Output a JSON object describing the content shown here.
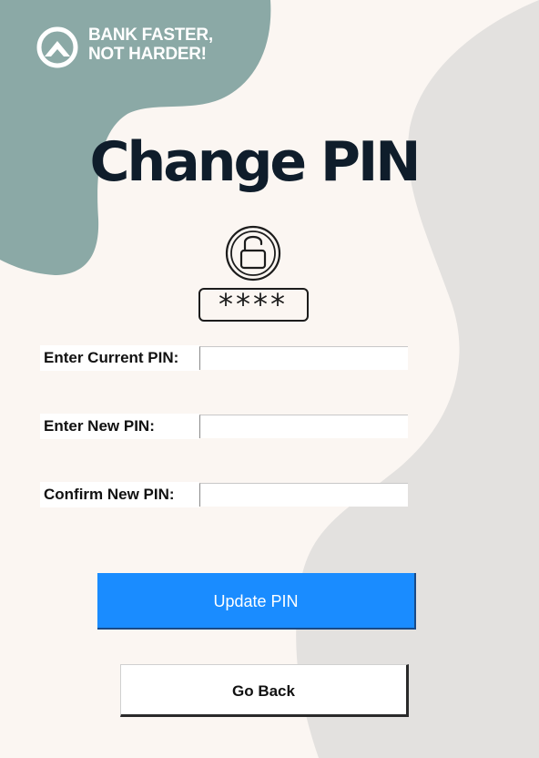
{
  "brand": {
    "line1": "BANK FASTER,",
    "line2": "NOT HARDER!",
    "logo_icon": "mountain-logo-icon"
  },
  "page": {
    "title": "Change PIN"
  },
  "illustration": {
    "lock_icon": "unlocked-padlock-icon",
    "masked_pin": "****"
  },
  "form": {
    "current_pin": {
      "label": "Enter Current PIN:",
      "value": ""
    },
    "new_pin": {
      "label": "Enter New PIN:",
      "value": ""
    },
    "confirm_pin": {
      "label": "Confirm New PIN:",
      "value": ""
    }
  },
  "buttons": {
    "update_label": "Update PIN",
    "back_label": "Go Back"
  },
  "colors": {
    "background": "#fbf6f2",
    "teal_blob": "#8ba9a6",
    "gray_blob": "#e3e1df",
    "title": "#0f1d2b",
    "primary_button": "#1a8cff"
  }
}
